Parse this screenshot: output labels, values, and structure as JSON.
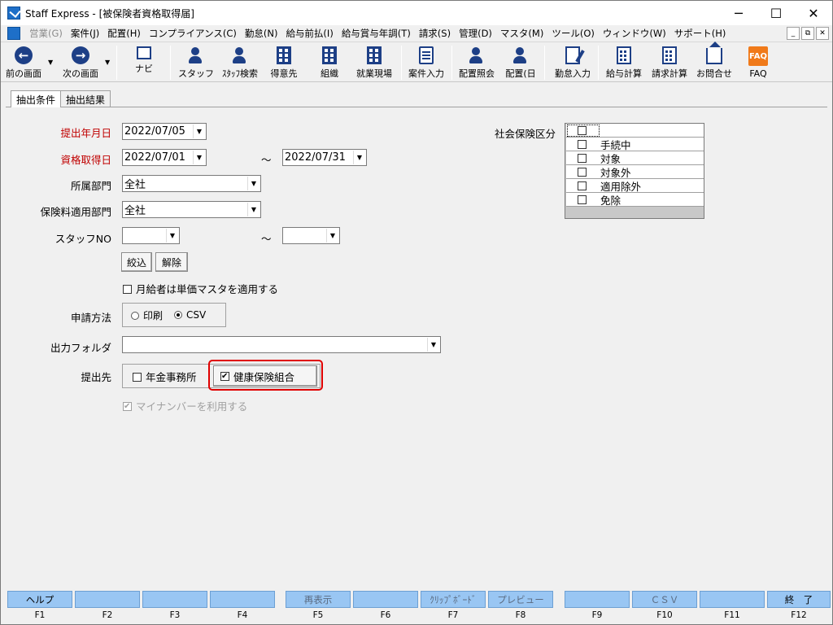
{
  "window": {
    "title": "Staff Express - [被保険者資格取得届]",
    "controls": {
      "minimize": "─",
      "maximize": "☐",
      "close": "✕"
    }
  },
  "menu": {
    "items": [
      {
        "label": "営業(G)",
        "disabled": true
      },
      {
        "label": "案件(J)"
      },
      {
        "label": "配置(H)"
      },
      {
        "label": "コンプライアンス(C)"
      },
      {
        "label": "勤怠(N)"
      },
      {
        "label": "給与前払(I)"
      },
      {
        "label": "給与賞与年調(T)"
      },
      {
        "label": "請求(S)"
      },
      {
        "label": "管理(D)"
      },
      {
        "label": "マスタ(M)"
      },
      {
        "label": "ツール(O)"
      },
      {
        "label": "ウィンドウ(W)"
      },
      {
        "label": "サポート(H)"
      }
    ],
    "mdi_controls": {
      "minimize": "_",
      "restore": "⧉",
      "close": "✕"
    }
  },
  "toolbar": {
    "prev": "前の画面",
    "next": "次の画面",
    "navi": "ナビ",
    "staff": "スタッフ",
    "staff_search": "ｽﾀｯﾌ検索",
    "client": "得意先",
    "org": "組織",
    "worksite": "就業現場",
    "case_input": "案件入力",
    "assign_inquiry": "配置照会",
    "assign_day": "配置(日",
    "attendance_input": "勤怠入力",
    "payroll_calc": "給与計算",
    "billing_calc": "請求計算",
    "contact": "お問合せ",
    "faq": "FAQ",
    "faq_icon": "FAQ"
  },
  "tabs": [
    {
      "label": "抽出条件",
      "active": true
    },
    {
      "label": "抽出結果",
      "active": false
    }
  ],
  "form": {
    "submit_date": {
      "label": "提出年月日",
      "value": "2022/07/05"
    },
    "acquire_date": {
      "label": "資格取得日",
      "from": "2022/07/01",
      "sep": "～",
      "to": "2022/07/31"
    },
    "department": {
      "label": "所属部門",
      "value": "全社"
    },
    "premium_department": {
      "label": "保険料適用部門",
      "value": "全社"
    },
    "staff_no": {
      "label": "スタッフNO",
      "from": "",
      "sep": "～",
      "to": ""
    },
    "filter_button": "絞込",
    "clear_button": "解除",
    "monthly_unit_master": {
      "label": "月給者は単価マスタを適用する",
      "checked": false
    },
    "method": {
      "label": "申請方法",
      "options": [
        {
          "label": "印刷",
          "checked": false
        },
        {
          "label": "CSV",
          "checked": true
        }
      ]
    },
    "output_folder": {
      "label": "出力フォルダ",
      "value": ""
    },
    "destination": {
      "label": "提出先",
      "pension_office": {
        "label": "年金事務所",
        "checked": false
      },
      "health_union": {
        "label": "健康保険組合",
        "checked": true
      }
    },
    "my_number": {
      "label": "マイナンバーを利用する",
      "checked": true,
      "disabled": true
    },
    "social_insurance": {
      "label": "社会保険区分",
      "items": [
        {
          "label": "",
          "checked": false
        },
        {
          "label": "手続中",
          "checked": false
        },
        {
          "label": "対象",
          "checked": false
        },
        {
          "label": "対象外",
          "checked": false
        },
        {
          "label": "適用除外",
          "checked": false
        },
        {
          "label": "免除",
          "checked": false
        }
      ]
    }
  },
  "fkeys": [
    {
      "label": "ヘルプ",
      "key": "F1"
    },
    {
      "label": "",
      "key": "F2"
    },
    {
      "label": "",
      "key": "F3"
    },
    {
      "label": "",
      "key": "F4"
    },
    {
      "label": "再表示",
      "key": "F5",
      "dim": true
    },
    {
      "label": "",
      "key": "F6"
    },
    {
      "label": "ｸﾘｯﾌﾟﾎﾞｰﾄﾞ",
      "key": "F7",
      "dim": true
    },
    {
      "label": "プレビュー",
      "key": "F8",
      "dim": true
    },
    {
      "label": "",
      "key": "F9"
    },
    {
      "label": "ＣＳＶ",
      "key": "F10",
      "dim": true
    },
    {
      "label": "",
      "key": "F11"
    },
    {
      "label": "終　了",
      "key": "F12"
    }
  ],
  "colors": {
    "accent_blue": "#99c6f3",
    "required_red": "#c00000",
    "highlight_red": "#e00000"
  }
}
